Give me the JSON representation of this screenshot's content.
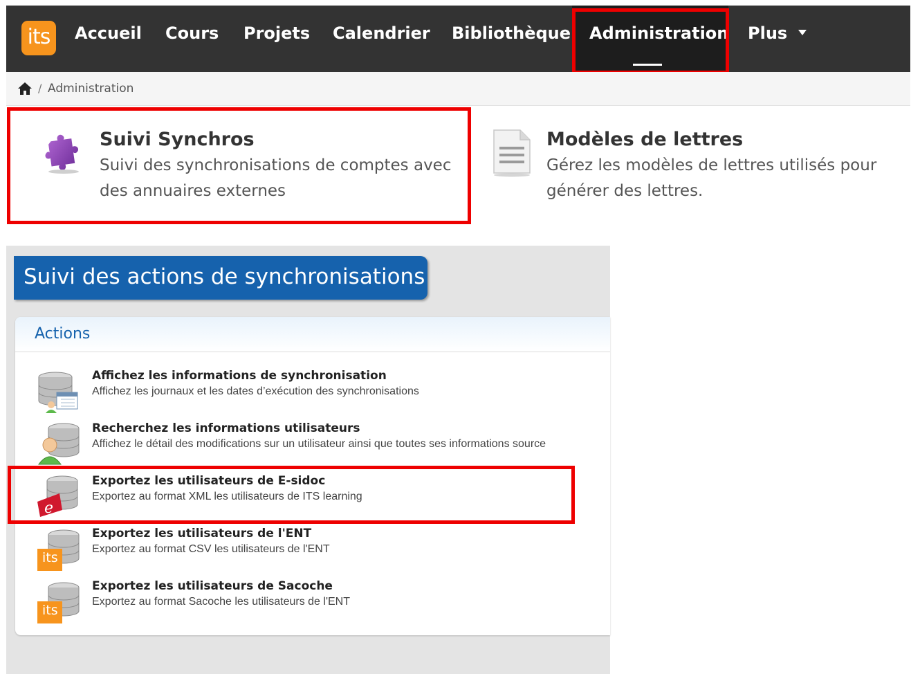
{
  "topnav": {
    "logo": "its",
    "items": [
      "Accueil",
      "Cours",
      "Projets",
      "Calendrier",
      "Bibliothèque",
      "Administration",
      "Plus"
    ],
    "active": "Administration"
  },
  "breadcrumb": {
    "current": "Administration",
    "separator": "/"
  },
  "cards": [
    {
      "title": "Suivi Synchros",
      "desc_line1": "Suivi des synchronisations de comptes avec",
      "desc_line2": "des annuaires externes",
      "icon": "puzzle-icon"
    },
    {
      "title": "Modèles de lettres",
      "desc_line1": "Gérez les modèles de lettres utilisés pour",
      "desc_line2": "générer des lettres.",
      "icon": "document-icon"
    }
  ],
  "panel": {
    "title": "Suivi des actions de synchronisations",
    "actions_heading": "Actions",
    "actions": [
      {
        "title": "Affichez les informations de synchronisation",
        "desc": "Affichez les journaux et les dates d’exécution des synchronisations",
        "icon": "database-calendar-icon"
      },
      {
        "title": "Recherchez les informations utilisateurs",
        "desc": "Affichez le détail des modifications sur un utilisateur ainsi que toutes ses informations source",
        "icon": "database-user-icon"
      },
      {
        "title": "Exportez les utilisateurs de E-sidoc",
        "desc": "Exportez au format XML les utilisateurs de ITS learning",
        "icon": "database-esidoc-icon"
      },
      {
        "title": "Exportez les utilisateurs de l'ENT",
        "desc": "Exportez au format CSV les utilisateurs de l'ENT",
        "icon": "database-its-icon",
        "badge": "its"
      },
      {
        "title": "Exportez les utilisateurs de Sacoche",
        "desc": "Exportez au format Sacoche les utilisateurs de l'ENT",
        "icon": "database-its-icon",
        "badge": "its"
      }
    ]
  },
  "colors": {
    "nav_bg": "#333333",
    "logo_orange": "#f7941d",
    "panel_blue": "#1662ad",
    "highlight_red": "#ee0000"
  }
}
